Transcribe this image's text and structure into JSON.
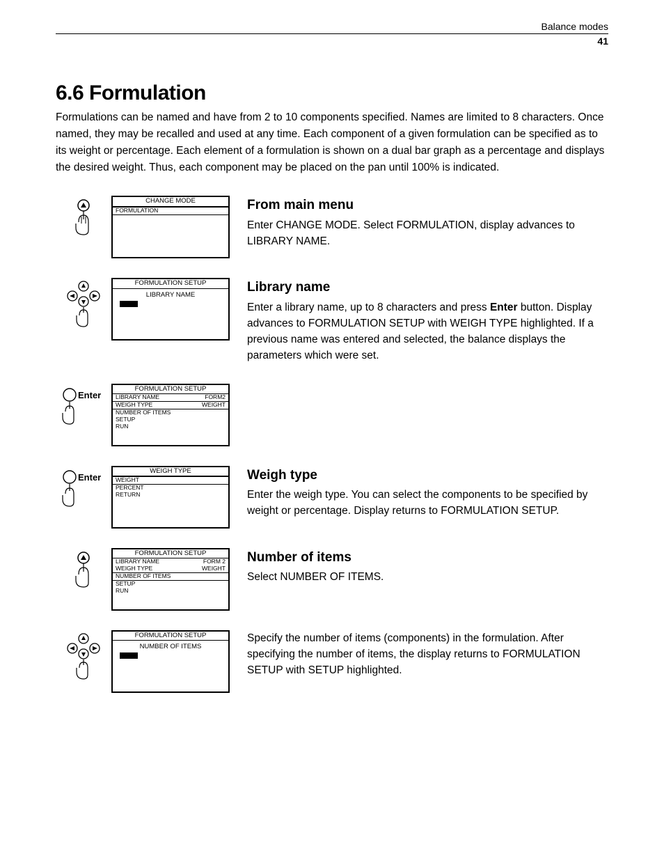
{
  "header": {
    "chapter": "Balance modes",
    "page": "41"
  },
  "title": "6.6  Formulation",
  "intro": "Formulations can be named and have from 2 to 10 components specified. Names are limited to 8 characters. Once named, they may be recalled and used at any time. Each component of a given formulation can be specified as to its weight or percentage. Each element of a formulation is shown on a dual bar graph as a percentage and displays the desired weight. Thus, each component may be placed on the pan until 100% is indicated.",
  "sections": [
    {
      "heading": "From main menu",
      "body": "Enter CHANGE MODE. Select FORMULATION, display advances to LIBRARY NAME."
    },
    {
      "heading": "Library name",
      "body_html": "Enter a library name, up to 8 characters and press <b>Enter</b> button. Display advances to FORMULATION SETUP with WEIGH TYPE highlighted. If a previous name was entered and selected, the balance displays the parameters which were set."
    },
    {
      "heading": "",
      "body": ""
    },
    {
      "heading": "Weigh type",
      "body": "Enter the weigh type. You can select the components to be specified by weight or percentage. Display returns to FORMULATION SETUP."
    },
    {
      "heading": "Number of items",
      "body": "Select NUMBER OF ITEMS."
    },
    {
      "heading": "",
      "body": "Specify the number of items (components) in the formulation. After specifying the number of items, the display returns to FORMULATION SETUP with SETUP highlighted."
    }
  ],
  "lcd": {
    "s1": {
      "title": "CHANGE MODE",
      "sel": "FORMULATION"
    },
    "s2": {
      "title": "FORMULATION SETUP",
      "sub": "LIBRARY NAME"
    },
    "s3": {
      "title": "FORMULATION SETUP",
      "rows": [
        [
          "LIBRARY NAME",
          "FORM2"
        ],
        [
          "WEIGH TYPE",
          "WEIGHT"
        ],
        [
          "NUMBER OF ITEMS",
          ""
        ],
        [
          "SETUP",
          ""
        ],
        [
          "RUN",
          ""
        ]
      ],
      "sel_index": 1
    },
    "s4": {
      "title": "WEIGH TYPE",
      "rows": [
        [
          "WEIGHT",
          ""
        ],
        [
          "PERCENT",
          ""
        ],
        [
          "RETURN",
          ""
        ]
      ],
      "sel_index": 0
    },
    "s5": {
      "title": "FORMULATION SETUP",
      "rows": [
        [
          "LIBRARY NAME",
          "FORM 2"
        ],
        [
          "WEIGH TYPE",
          "WEIGHT"
        ],
        [
          "NUMBER OF ITEMS",
          ""
        ],
        [
          "SETUP",
          ""
        ],
        [
          "RUN",
          ""
        ]
      ],
      "sel_index": 2
    },
    "s6": {
      "title": "FORMULATION SETUP",
      "sub": "NUMBER OF ITEMS"
    }
  },
  "icons": {
    "enter": "Enter"
  }
}
